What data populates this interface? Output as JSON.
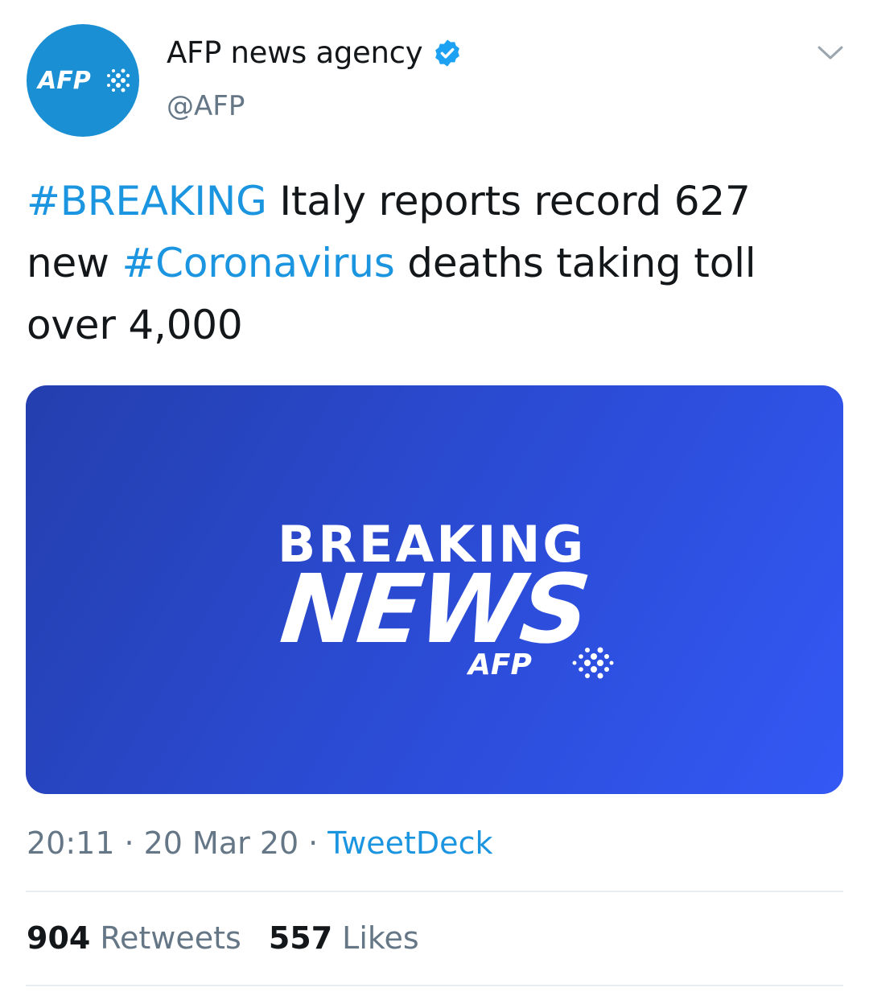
{
  "author": {
    "display_name": "AFP news agency",
    "handle": "@AFP",
    "avatar_icon": "afp-logo-icon",
    "avatar_text": "AFP",
    "verified_icon": "verified-badge-icon",
    "menu_icon": "chevron-down-icon"
  },
  "tweet": {
    "hashtag1": "#BREAKING",
    "text1": " Italy reports record 627 new ",
    "hashtag2": "#Coronavirus",
    "text2": " deaths taking toll over 4,000"
  },
  "media": {
    "line1": "BREAKING",
    "line2": "NEWS",
    "logo_text": "AFP"
  },
  "meta": {
    "time": "20:11",
    "sep": "·",
    "date": "20 Mar 20",
    "source": "TweetDeck"
  },
  "stats": {
    "retweets_count": "904",
    "retweets_label": "Retweets",
    "likes_count": "557",
    "likes_label": "Likes"
  },
  "colors": {
    "accent": "#1b95e0",
    "avatar_bg": "#1a8fd3",
    "media_bg": "#2b4bd4"
  }
}
